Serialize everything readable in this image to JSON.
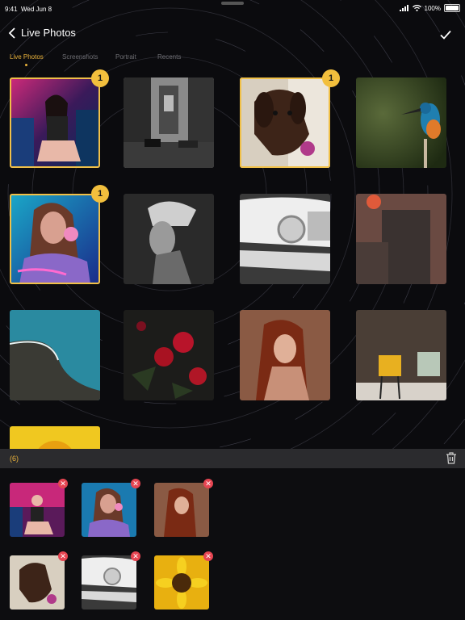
{
  "status_bar": {
    "time": "9:41",
    "date": "Wed Jun 8",
    "battery": "100%"
  },
  "nav": {
    "title": "Live Photos"
  },
  "tabs": [
    {
      "label": "Live Photos",
      "active": true
    },
    {
      "label": "Screenshots",
      "active": false
    },
    {
      "label": "Portrait",
      "active": false
    },
    {
      "label": "Recents",
      "active": false
    }
  ],
  "grid": [
    {
      "subject": "woman-neon-arcade",
      "selected": true,
      "order": "1"
    },
    {
      "subject": "manhattan-bridge-street",
      "selected": false
    },
    {
      "subject": "brown-dog-ball",
      "selected": true,
      "order": "1"
    },
    {
      "subject": "kingfisher-bird",
      "selected": false
    },
    {
      "subject": "girl-bubblegum-neon",
      "selected": true,
      "order": "1"
    },
    {
      "subject": "bw-portrait-woman",
      "selected": false
    },
    {
      "subject": "vintage-car-headlight",
      "selected": false
    },
    {
      "subject": "sunset-buildings",
      "selected": false
    },
    {
      "subject": "ocean-coast-aerial",
      "selected": false
    },
    {
      "subject": "red-flowers",
      "selected": false
    },
    {
      "subject": "red-hair-woman",
      "selected": false
    },
    {
      "subject": "yellow-chairs",
      "selected": false
    },
    {
      "subject": "sunflower",
      "selected": false
    }
  ],
  "tray": {
    "count_label": "(6)"
  },
  "tray_items": [
    {
      "subject": "woman-neon-arcade"
    },
    {
      "subject": "girl-bubblegum-neon"
    },
    {
      "subject": "red-hair-woman"
    },
    {
      "subject": "brown-dog-ball"
    },
    {
      "subject": "vintage-car-headlight"
    },
    {
      "subject": "sunflower"
    }
  ],
  "colors": {
    "accent": "#f2bf3d",
    "remove": "#e64552",
    "background": "#0b0b0e"
  }
}
